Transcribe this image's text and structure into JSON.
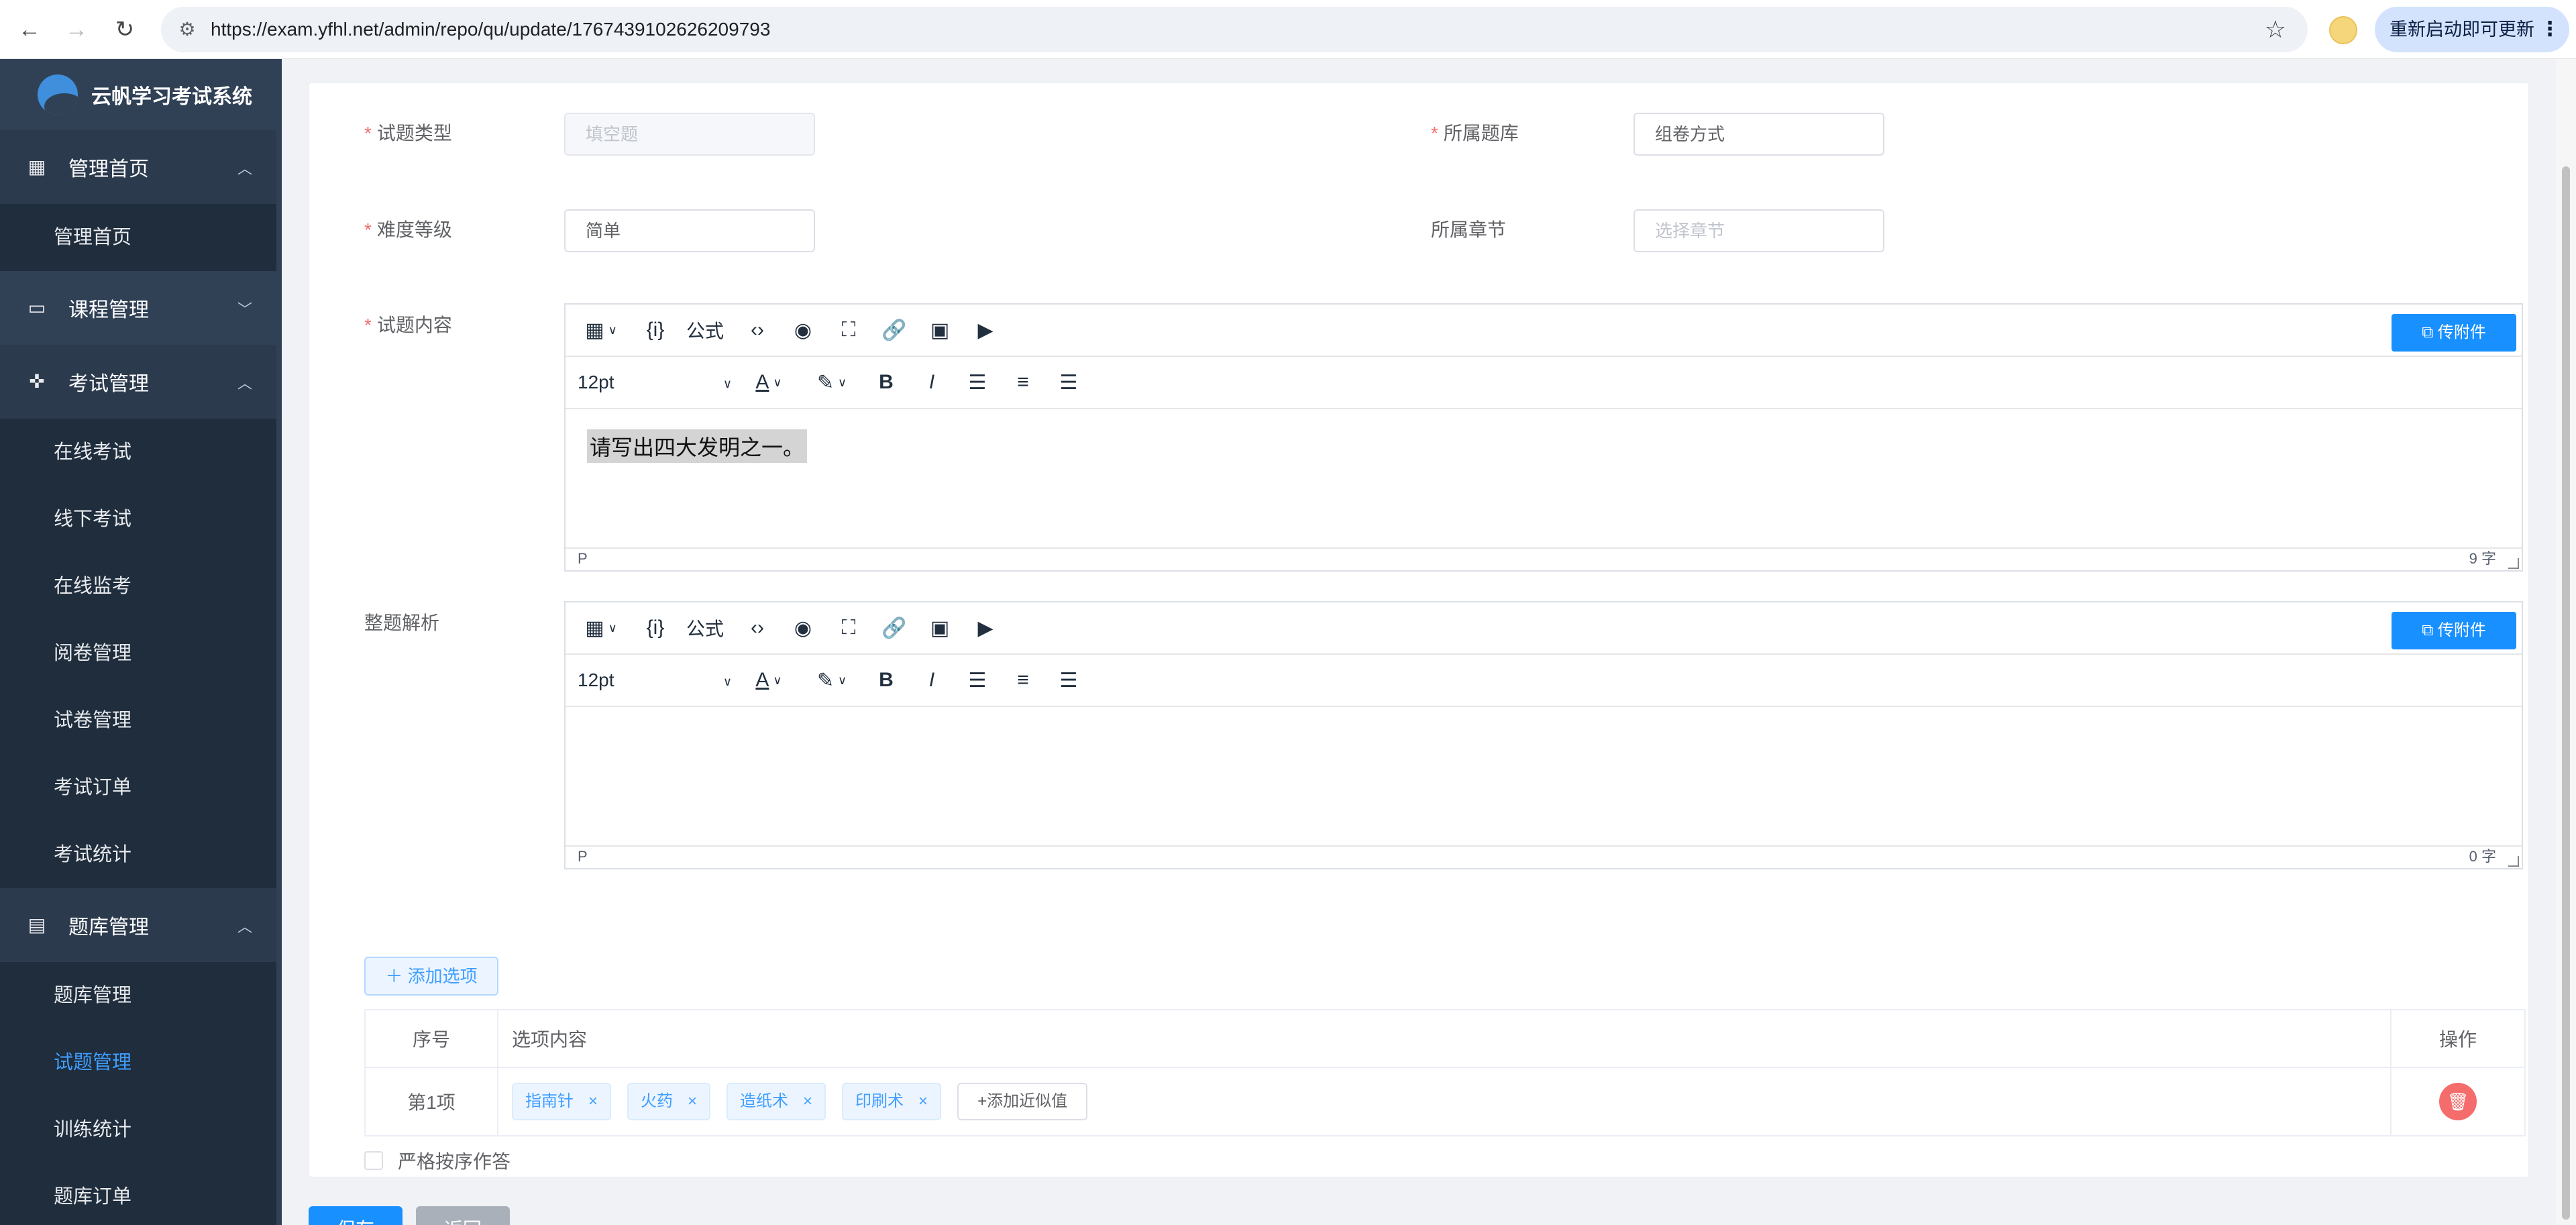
{
  "browser": {
    "url": "https://exam.yfhl.net/admin/repo/qu/update/1767439102626209793",
    "update_label": "重新启动即可更新"
  },
  "sidebar": {
    "app_title": "云帆学习考试系统",
    "groups": [
      {
        "label": "管理首页",
        "expanded": true,
        "items": [
          {
            "label": "管理首页"
          }
        ]
      },
      {
        "label": "课程管理",
        "expanded": false,
        "items": []
      },
      {
        "label": "考试管理",
        "expanded": true,
        "items": [
          {
            "label": "在线考试"
          },
          {
            "label": "线下考试"
          },
          {
            "label": "在线监考"
          },
          {
            "label": "阅卷管理"
          },
          {
            "label": "试卷管理"
          },
          {
            "label": "考试订单"
          },
          {
            "label": "考试统计"
          }
        ]
      },
      {
        "label": "题库管理",
        "expanded": true,
        "items": [
          {
            "label": "题库管理"
          },
          {
            "label": "试题管理",
            "active": true
          },
          {
            "label": "训练统计"
          },
          {
            "label": "题库订单"
          }
        ]
      }
    ]
  },
  "form": {
    "qu_type": {
      "label": "试题类型",
      "value": "填空题"
    },
    "repo": {
      "label": "所属题库",
      "value": "组卷方式"
    },
    "level": {
      "label": "难度等级",
      "value": "简单"
    },
    "chapter": {
      "label": "所属章节",
      "placeholder": "选择章节"
    },
    "content": {
      "label": "试题内容",
      "text": "请写出四大发明之一。",
      "word_count": "9 字",
      "path": "P"
    },
    "analysis": {
      "label": "整题解析",
      "text": "",
      "word_count": "0 字",
      "path": "P"
    }
  },
  "editor_toolbar": {
    "formula_label": "公式",
    "font_size": "12pt",
    "attach_label": "传附件"
  },
  "options": {
    "add_label": "添加选项",
    "columns": [
      "序号",
      "选项内容",
      "操作"
    ],
    "rows": [
      {
        "index": "第1项",
        "answers": [
          "指南针",
          "火药",
          "造纸术",
          "印刷术"
        ],
        "add_similar_label": "+添加近似值"
      }
    ]
  },
  "strict_order_label": "严格按序作答",
  "actions": {
    "save": "保存",
    "back": "返回"
  },
  "colors": {
    "primary": "#1890ff",
    "sidebar_bg": "#304156",
    "danger": "#f56c6c",
    "active_menu": "#409eff"
  }
}
